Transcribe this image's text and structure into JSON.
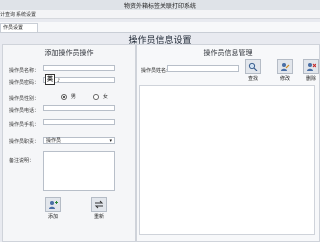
{
  "app": {
    "window_title": "物资外箱标签关联打印系统"
  },
  "menu": [
    "计查询",
    "系统设置"
  ],
  "tab": {
    "label": "作员设置"
  },
  "page": {
    "title": "操作员信息设置"
  },
  "left_panel": {
    "title": "添加操作员操作",
    "fields": {
      "name_label": "操作员名称：",
      "password_label": "操作员密码：",
      "password_ime_char": "英",
      "password_suffix": "♪",
      "gender_label": "操作员性别：",
      "gender_options": [
        "男",
        "女"
      ],
      "phone_label": "操作员电话：",
      "mobile_label": "操作员手机：",
      "role_label": "操作员职责：",
      "role_value": "操作员",
      "remark_label": "备注说明："
    },
    "buttons": {
      "add": "添加",
      "reset": "重新"
    }
  },
  "right_panel": {
    "title": "操作员信息管理",
    "search_label": "操作员姓名:",
    "buttons": {
      "search": "查找",
      "edit": "修改",
      "delete": "删除"
    }
  }
}
